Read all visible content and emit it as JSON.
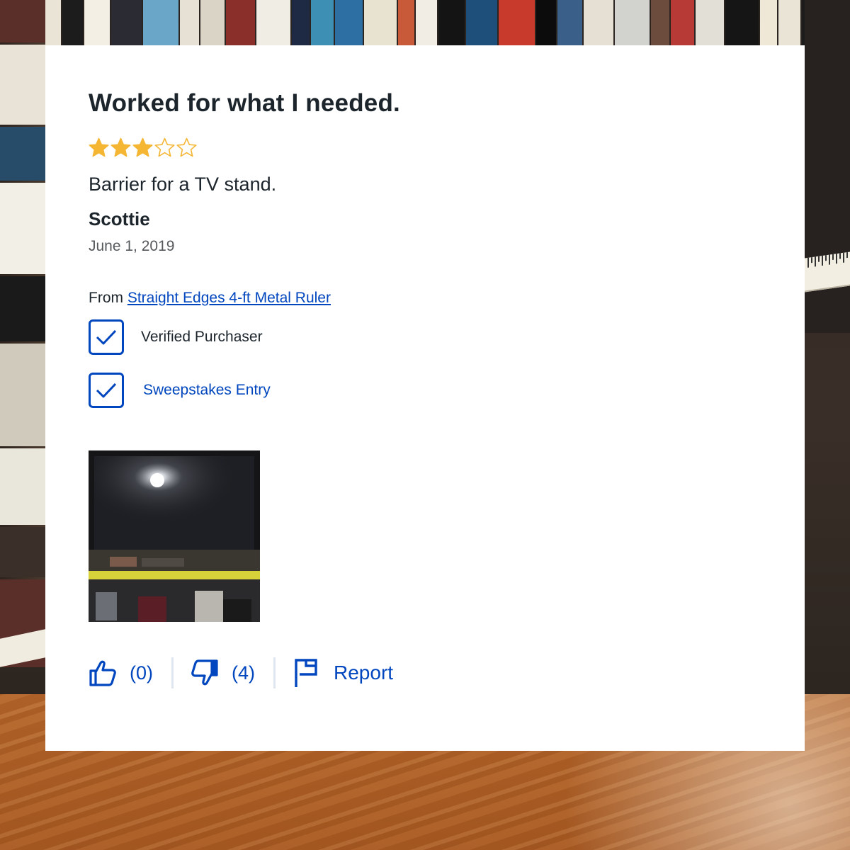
{
  "review": {
    "title": "Worked for what I needed.",
    "rating": 3,
    "rating_max": 5,
    "body": "Barrier for a TV stand.",
    "author": "Scottie",
    "date": "June 1, 2019",
    "from_prefix": "From",
    "product_link": "Straight Edges 4-ft Metal Ruler",
    "badges": {
      "verified": "Verified Purchaser",
      "sweepstakes": "Sweepstakes Entry"
    }
  },
  "actions": {
    "helpful_count": "(0)",
    "unhelpful_count": "(4)",
    "report_label": "Report"
  },
  "colors": {
    "accent_blue": "#0046be",
    "star_gold": "#f4b633",
    "text_dark": "#1d252c",
    "text_muted": "#55595c"
  },
  "icons": {
    "helpful": "thumbs-up-icon",
    "unhelpful": "thumbs-down-icon",
    "report": "flag-icon",
    "badge_check": "checkmark-icon"
  }
}
